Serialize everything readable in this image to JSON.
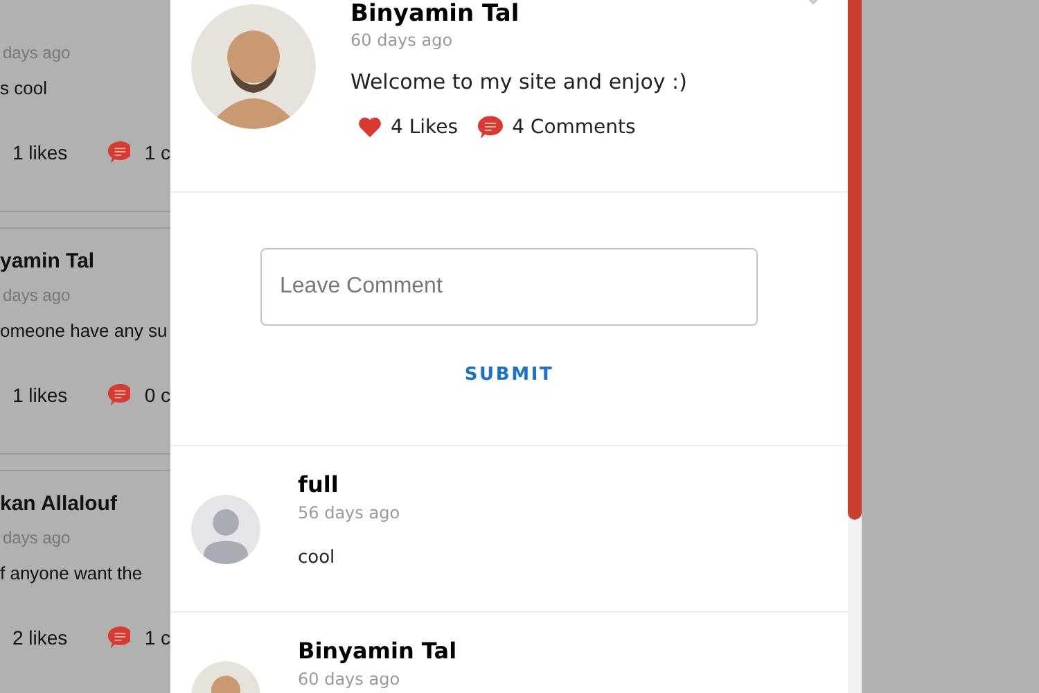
{
  "background_posts": [
    {
      "time": "days ago",
      "text": "s cool",
      "likes": "1 likes",
      "comments": "1 c"
    },
    {
      "author": "yamin Tal",
      "time": "days ago",
      "text": "omeone have any su",
      "likes": "1 likes",
      "comments": "0 c"
    },
    {
      "author": "kan Allalouf",
      "time": "days ago",
      "text": "f anyone want the",
      "likes": "2 likes",
      "comments": "1 c"
    }
  ],
  "modal": {
    "post": {
      "author": "Binyamin Tal",
      "time": "60 days ago",
      "text": "Welcome to my site and enjoy :)",
      "likes": "4 Likes",
      "comments": "4 Comments",
      "kind": "photo"
    },
    "comment_field": {
      "placeholder": "Leave Comment"
    },
    "submit": "SUBMIT",
    "comments": [
      {
        "author": "full",
        "time": "56 days ago",
        "text": "cool",
        "kind": "default"
      },
      {
        "author": "Binyamin Tal",
        "time": "60 days ago",
        "kind": "photo"
      }
    ]
  }
}
